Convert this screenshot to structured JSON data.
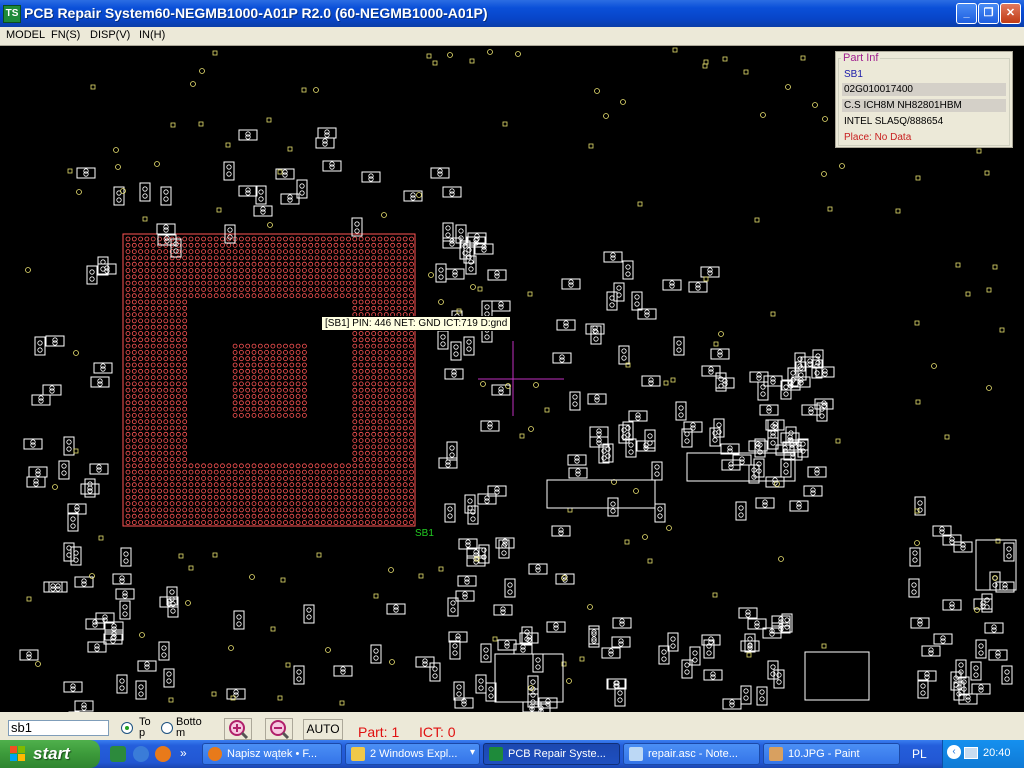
{
  "window": {
    "title": "PCB Repair System60-NEGMB1000-A01P R2.0   (60-NEGMB1000-A01P)",
    "app_icon_label": "TS",
    "controls": [
      "minimize",
      "maximize",
      "close"
    ]
  },
  "menu": [
    "MODEL",
    "FN(S)",
    "DISP(V)",
    "IN(H)"
  ],
  "part_info": {
    "legend": "Part Inf",
    "lines": [
      "SB1",
      "02G010017400",
      "C.S ICH8M NH82801HBM",
      "INTEL SLA5Q/888654",
      "Place: No Data"
    ],
    "colors": {
      "id": "#1a1aa8",
      "text": "#000000",
      "place": "#c82020"
    }
  },
  "tooltip": "[SB1] PIN: 446  NET: GND  ICT:719  D:gnd",
  "board": {
    "component_label": "SB1",
    "colors": {
      "background": "#000000",
      "pads": "#ff5555",
      "outline": "#ffffff",
      "via": "#e8e070",
      "crosshair": "#c030c0",
      "label": "#22cc22"
    }
  },
  "controls": {
    "search_value": "sb1",
    "radio_top_label": "To\np",
    "radio_bottom_label": "Botto\nm",
    "zoom_in_icon": "zoom-in-icon",
    "zoom_out_icon": "zoom-out-icon",
    "auto_label": "AUTO",
    "part_status": "Part: 1",
    "ict_status": "ICT: 0"
  },
  "taskbar": {
    "start_label": "start",
    "tasks": [
      {
        "label": "Napisz wątek • F...",
        "icon": "firefox-icon"
      },
      {
        "label": "2 Windows Expl...",
        "icon": "folder-icon"
      },
      {
        "label": "PCB Repair Syste...",
        "icon": "pcb-icon"
      },
      {
        "label": "repair.asc - Note...",
        "icon": "notepad-icon"
      },
      {
        "label": "10.JPG - Paint",
        "icon": "paint-icon"
      }
    ],
    "language": "PL",
    "clock": "20:40"
  }
}
